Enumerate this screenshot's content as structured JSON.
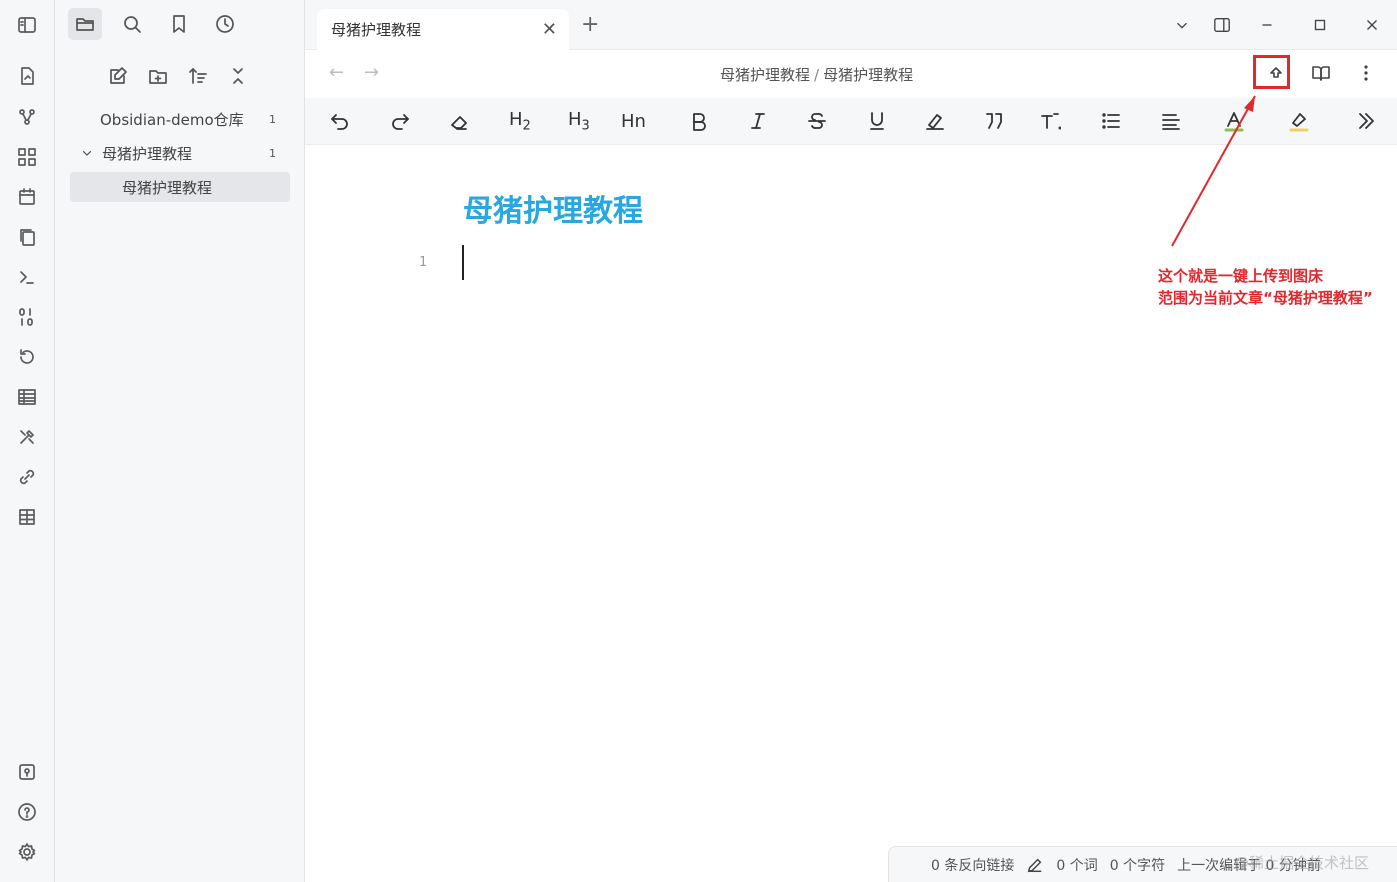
{
  "sidebar_tree": {
    "vault_name": "Obsidian-demo仓库",
    "vault_count": "1",
    "folder_name": "母猪护理教程",
    "folder_count": "1",
    "file_name": "母猪护理教程"
  },
  "tab": {
    "title": "母猪护理教程",
    "close": "✕",
    "new": "+"
  },
  "view_header": {
    "back": "←",
    "forward": "→",
    "breadcrumb_folder": "母猪护理教程",
    "breadcrumb_sep": "/",
    "breadcrumb_file": "母猪护理教程"
  },
  "toolbar": {
    "h2": "H",
    "h2_sub": "2",
    "h3": "H",
    "h3_sub": "3",
    "hn": "Hn"
  },
  "editor": {
    "title": "母猪护理教程",
    "line_number": "1"
  },
  "annotation": {
    "line1": "这个就是一键上传到图床",
    "line2": "范围为当前文章“母猪护理教程”",
    "color": "#e0282d"
  },
  "status": {
    "backlinks": "0 条反向链接",
    "words": "0 个词",
    "chars": "0 个字符",
    "last_edit": "上一次编辑于 0 分钟前"
  },
  "watermark": "@稀土掘金技术社区",
  "colors": {
    "title_blue": "#29a8e0",
    "accent_red": "#e0282d"
  }
}
